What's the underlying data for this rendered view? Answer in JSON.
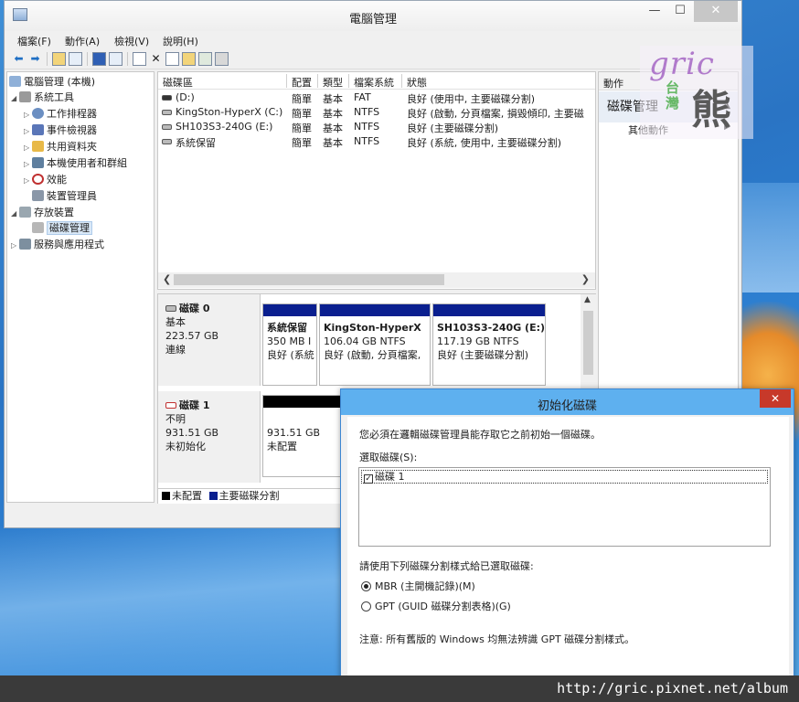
{
  "window": {
    "title": "電腦管理",
    "minimize_glyph": "—",
    "maximize_glyph": "☐",
    "close_glyph": "✕"
  },
  "menu": [
    "檔案(F)",
    "動作(A)",
    "檢視(V)",
    "說明(H)"
  ],
  "toolbar": {
    "icons": [
      "back-icon",
      "forward-icon",
      "up-folder-icon",
      "show-tree-icon",
      "help-icon",
      "details-icon",
      "refresh-icon",
      "delete-icon",
      "properties-icon",
      "open-icon",
      "search-icon",
      "disk-icon"
    ],
    "back_glyph": "⬅",
    "forward_glyph": "➡",
    "delete_glyph": "✕"
  },
  "tree": {
    "root": "電腦管理 (本機)",
    "system_tools": "系統工具",
    "task_scheduler": "工作排程器",
    "event_viewer": "事件檢視器",
    "shared_folders": "共用資料夾",
    "local_users": "本機使用者和群組",
    "performance": "效能",
    "device_manager": "裝置管理員",
    "storage": "存放裝置",
    "disk_management": "磁碟管理",
    "services": "服務與應用程式"
  },
  "volumes": {
    "columns": [
      "磁碟區",
      "配置",
      "類型",
      "檔案系統",
      "狀態"
    ],
    "rows": [
      {
        "name": "(D:)",
        "layout": "簡單",
        "type": "基本",
        "fs": "FAT",
        "status": "良好 (使用中, 主要磁碟分割)"
      },
      {
        "name": "KingSton-HyperX (C:)",
        "layout": "簡單",
        "type": "基本",
        "fs": "NTFS",
        "status": "良好 (啟動, 分頁檔案, 損毀傾印, 主要磁"
      },
      {
        "name": "SH103S3-240G (E:)",
        "layout": "簡單",
        "type": "基本",
        "fs": "NTFS",
        "status": "良好 (主要磁碟分割)"
      },
      {
        "name": "系統保留",
        "layout": "簡單",
        "type": "基本",
        "fs": "NTFS",
        "status": "良好 (系統, 使用中, 主要磁碟分割)"
      }
    ]
  },
  "disks": [
    {
      "name": "磁碟 0",
      "type": "基本",
      "size": "223.57 GB",
      "state": "連線",
      "partitions": [
        {
          "name": "系統保留",
          "size": "350 MB I",
          "status": "良好 (系統"
        },
        {
          "name": "KingSton-HyperX",
          "size": "106.04 GB NTFS",
          "status": "良好 (啟動, 分頁檔案,"
        },
        {
          "name": "SH103S3-240G  (E:)",
          "size": "117.19 GB NTFS",
          "status": "良好 (主要磁碟分割)"
        }
      ]
    },
    {
      "name": "磁碟 1",
      "type": "不明",
      "size": "931.51 GB",
      "state": "未初始化",
      "partitions": [
        {
          "size": "931.51 GB",
          "status": "未配置"
        }
      ]
    }
  ],
  "legend": {
    "unallocated": "未配置",
    "primary": "主要磁碟分割",
    "unallocated_color": "#000000",
    "primary_color": "#0a1f8f"
  },
  "actions": {
    "header": "動作",
    "group": "磁碟管理",
    "more": "其他動作"
  },
  "watermark": {
    "script": "gric",
    "tw": "台灣",
    "bear": "熊"
  },
  "dialog": {
    "title": "初始化磁碟",
    "intro": "您必須在邏輯磁碟管理員能存取它之前初始一個磁碟。",
    "select_label": "選取磁碟(S):",
    "disk_item": "磁碟 1",
    "disk_checked": true,
    "style_label": "請使用下列磁碟分割樣式給已選取磁碟:",
    "mbr": "MBR (主開機記錄)(M)",
    "gpt": "GPT (GUID 磁碟分割表格)(G)",
    "selected_style": "MBR",
    "note": "注意: 所有舊版的 Windows 均無法辨識 GPT 磁碟分割樣式。"
  },
  "footer_url": "http://gric.pixnet.net/album"
}
